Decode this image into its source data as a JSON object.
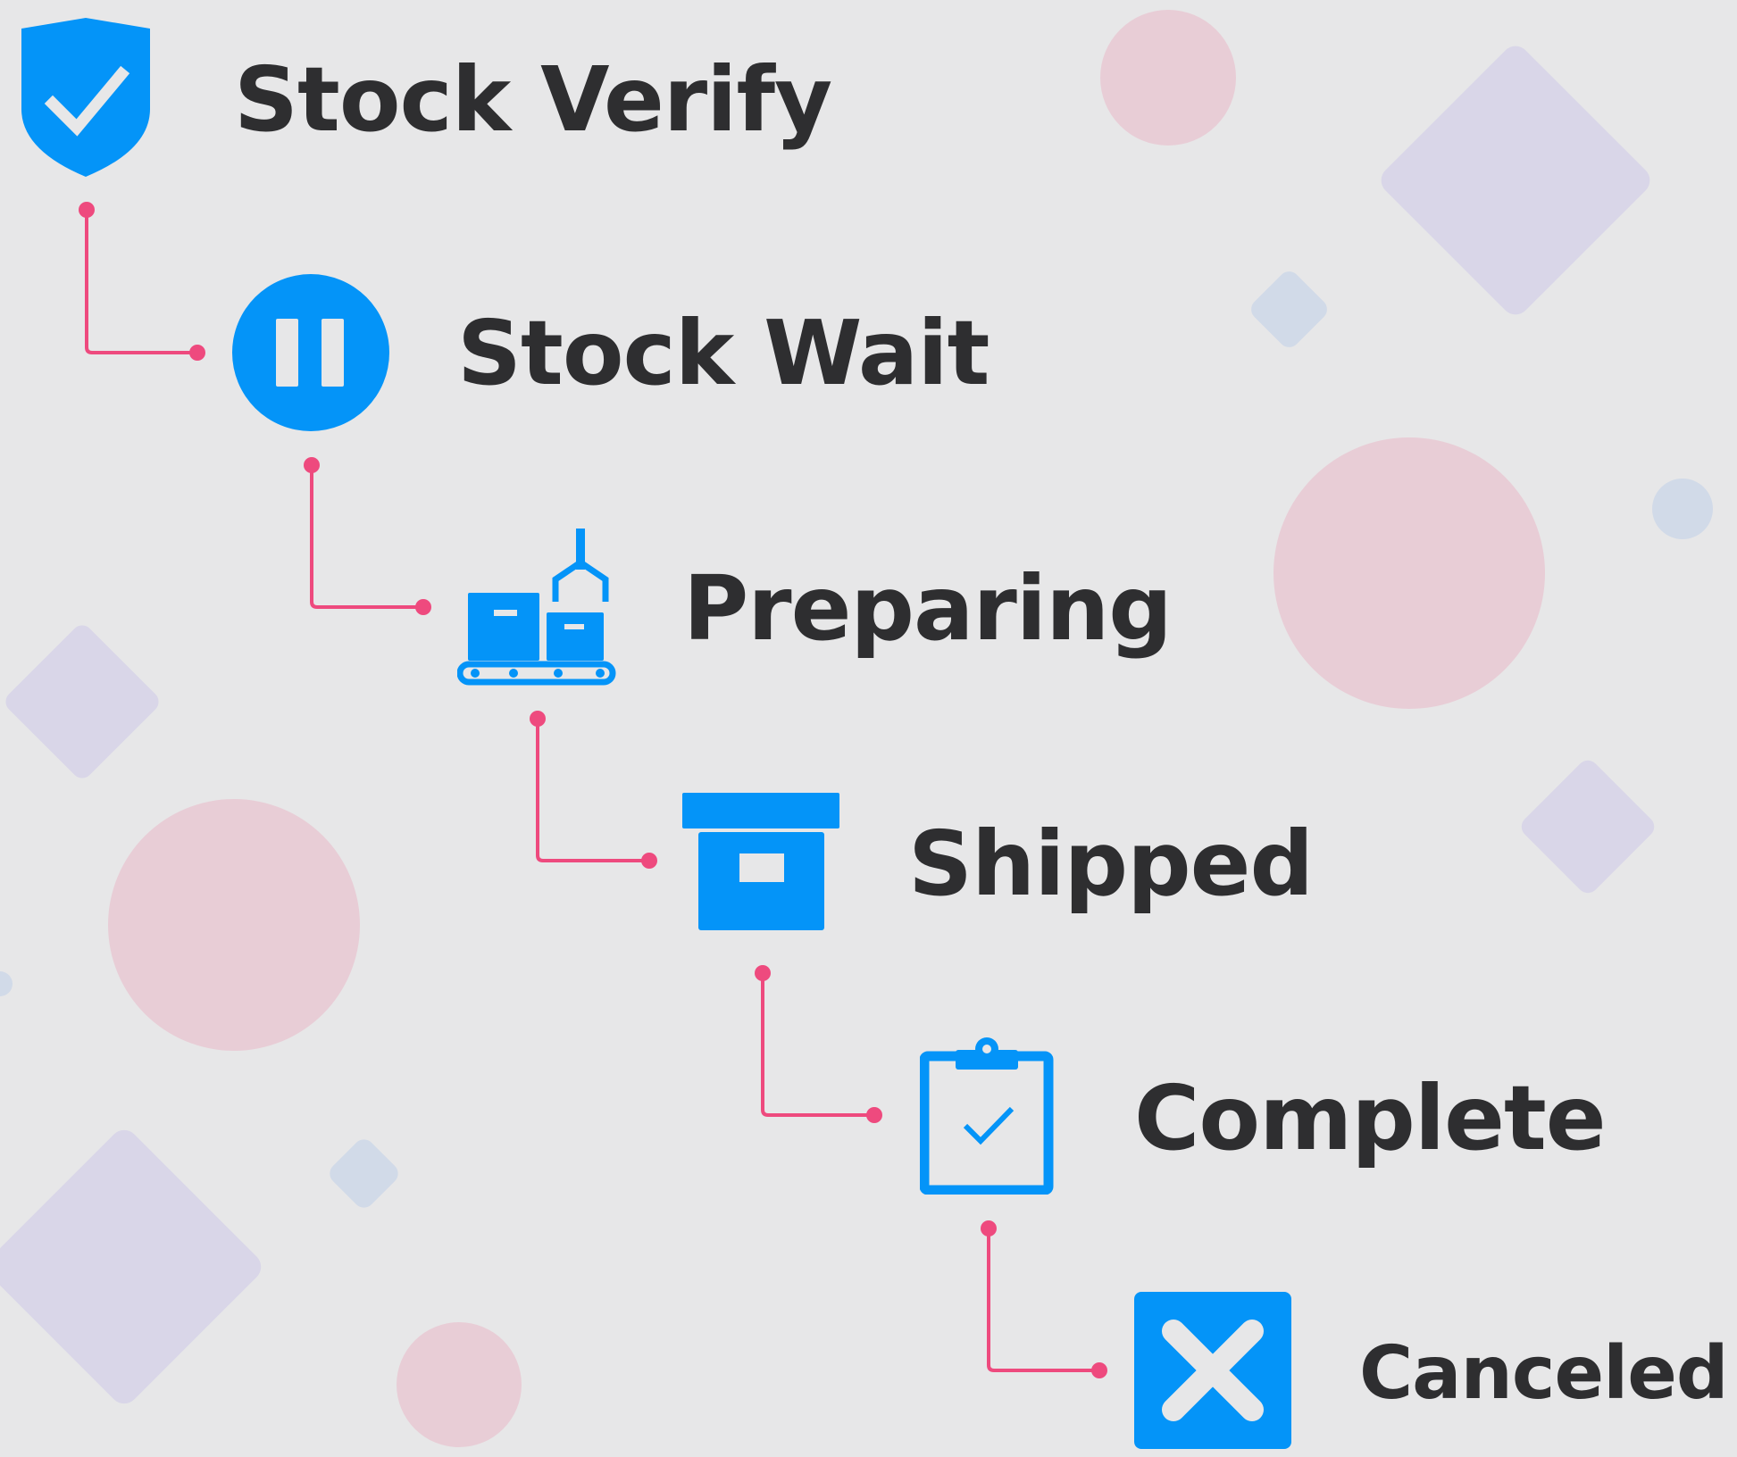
{
  "colors": {
    "background": "#E7E7E8",
    "icon": "#0494F8",
    "connector": "#EE4A7E",
    "label": "#2E2E30",
    "decor_pink": "#E8CDD6",
    "decor_lavender": "#D9D6E8",
    "decor_blue": "#D1DAE8"
  },
  "steps": [
    {
      "label": "Stock Verify",
      "icon": "shield-check-icon"
    },
    {
      "label": "Stock Wait",
      "icon": "pause-circle-icon"
    },
    {
      "label": "Preparing",
      "icon": "conveyor-boxes-icon"
    },
    {
      "label": "Shipped",
      "icon": "archive-box-icon"
    },
    {
      "label": "Complete",
      "icon": "clipboard-check-icon"
    },
    {
      "label": "Canceled",
      "icon": "close-square-icon"
    }
  ]
}
